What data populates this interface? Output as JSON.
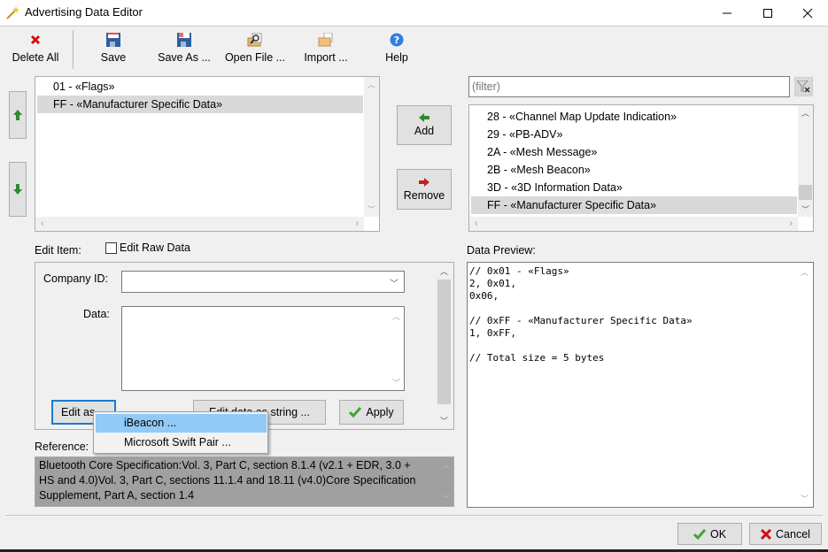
{
  "window": {
    "title": "Advertising Data Editor",
    "app_icon": "magic-wand-icon",
    "controls": [
      "minimize",
      "maximize",
      "close"
    ]
  },
  "toolbar": {
    "buttons": [
      {
        "label": "Delete All",
        "icon": "delete-x-icon"
      },
      {
        "label": "Save",
        "icon": "floppy-disk-icon"
      },
      {
        "label": "Save As ...",
        "icon": "floppy-disk-saveas-icon"
      },
      {
        "label": "Open File ...",
        "icon": "folder-search-icon"
      },
      {
        "label": "Import ...",
        "icon": "folder-import-icon"
      },
      {
        "label": "Help",
        "icon": "help-icon"
      }
    ]
  },
  "selected_list": {
    "items": [
      "01 - «Flags»",
      "FF - «Manufacturer Specific Data»"
    ],
    "selected_index": 1
  },
  "move_buttons": {
    "up_icon": "arrow-up-icon",
    "down_icon": "arrow-down-icon"
  },
  "add_button": {
    "label": "Add",
    "icon": "arrow-left-icon"
  },
  "remove_button": {
    "label": "Remove",
    "icon": "arrow-right-icon"
  },
  "filter": {
    "placeholder": "(filter)",
    "value": "",
    "clear_icon": "filter-clear-icon"
  },
  "available_list": {
    "items": [
      "28 - «Channel Map Update Indication»",
      "29 - «PB-ADV»",
      "2A - «Mesh Message»",
      "2B - «Mesh Beacon»",
      "3D - «3D Information Data»",
      "FF - «Manufacturer Specific Data»"
    ],
    "selected_index": 5
  },
  "edit_item": {
    "label": "Edit Item:",
    "raw_data_checkbox": {
      "label": "Edit Raw Data",
      "checked": false
    },
    "company_id": {
      "label": "Company ID:",
      "value": ""
    },
    "data": {
      "label": "Data:",
      "value": ""
    },
    "edit_as_button": "Edit as ...",
    "edit_string_button": "Edit data as string ...",
    "apply_button": "Apply"
  },
  "edit_as_menu": {
    "items": [
      "iBeacon ...",
      "Microsoft Swift Pair ..."
    ],
    "highlighted_index": 0
  },
  "reference": {
    "label": "Reference:",
    "lines": [
      "Bluetooth Core Specification:Vol. 3, Part C, section 8.1.4 (v2.1 + EDR, 3.0 +",
      "HS and 4.0)Vol. 3, Part C, sections 11.1.4 and 18.11 (v4.0)Core Specification",
      "Supplement, Part A, section 1.4"
    ]
  },
  "data_preview": {
    "label": "Data Preview:",
    "text": "// 0x01 - «Flags»\n2, 0x01,\n0x06,\n\n// 0xFF - «Manufacturer Specific Data»\n1, 0xFF,\n\n// Total size = 5 bytes"
  },
  "footer": {
    "ok": "OK",
    "cancel": "Cancel"
  },
  "colors": {
    "selection": "#d9d9d9",
    "menu_highlight": "#91c9f7",
    "ok_green": "#3fa535",
    "cancel_red": "#d01010"
  }
}
